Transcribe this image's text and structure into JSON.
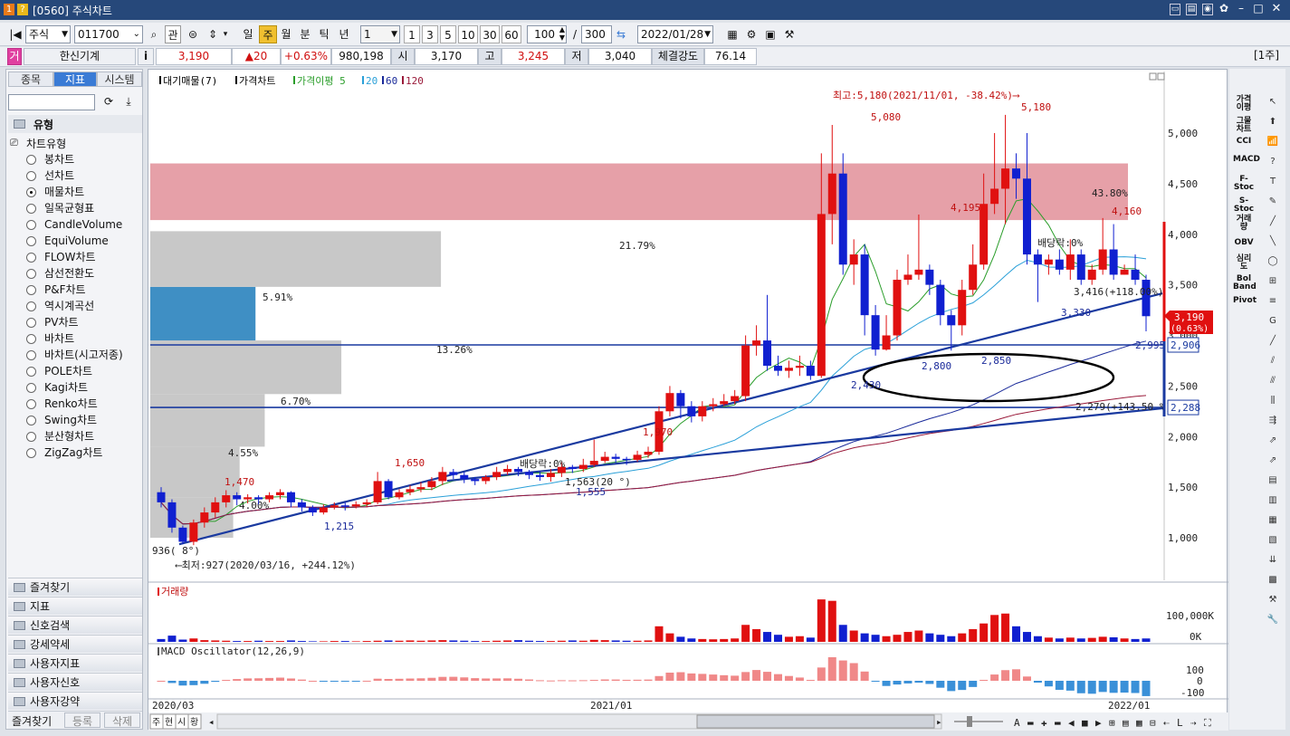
{
  "window": {
    "title": "[0560] 주식차트",
    "badges": [
      "1",
      "?"
    ]
  },
  "toolbar": {
    "market": "주식",
    "code": "011700",
    "gwan": "관",
    "periods": [
      "일",
      "주",
      "월",
      "분",
      "틱",
      "년"
    ],
    "active_period": "주",
    "interval": "1",
    "quick_intervals": [
      "1",
      "3",
      "5",
      "10",
      "30",
      "60"
    ],
    "count": "100",
    "slash": "/",
    "total": "300",
    "date": "2022/01/28"
  },
  "pricebar": {
    "name_badge": "거",
    "company": "한신기계",
    "info": "i",
    "price": "3,190",
    "change": "▲20",
    "change_pct": "+0.63%",
    "volume": "980,198",
    "open_label": "시",
    "open": "3,170",
    "high_label": "고",
    "high": "3,245",
    "low_label": "저",
    "low": "3,040",
    "strength_label": "체결강도",
    "strength": "76.14",
    "period_tag": "[1주]"
  },
  "left": {
    "tabs": [
      "종목",
      "지표",
      "시스템"
    ],
    "active_tab": "지표",
    "group": "유형",
    "tree_root": "차트유형",
    "chart_types": [
      "봉차트",
      "선차트",
      "매물차트",
      "일목균형표",
      "CandleVolume",
      "EquiVolume",
      "FLOW차트",
      "삼선전환도",
      "P&F차트",
      "역시계곡선",
      "PV차트",
      "바차트",
      "바차트(시고저종)",
      "POLE차트",
      "Kagi차트",
      "Renko차트",
      "Swing차트",
      "분산형차트",
      "ZigZag차트"
    ],
    "selected": "매물차트",
    "folders": [
      "즐겨찾기",
      "지표",
      "신호검색",
      "강세약세",
      "사용자지표",
      "사용자신호",
      "사용자강약"
    ],
    "footer": [
      "즐겨찾기",
      "등록",
      "삭제"
    ]
  },
  "legend": {
    "items": [
      "대기매물(7)",
      "가격차트",
      "가격이평 5",
      "20",
      "60",
      "120"
    ],
    "colors": [
      "#000000",
      "#000000",
      "#2a9d2a",
      "#2aa0d8",
      "#1a2a9a",
      "#9a1a3a"
    ]
  },
  "annotations": {
    "high": "최고:5,180(2021/11/01, -38.42%)⟶",
    "low": "⟵최저:927(2020/03/16, +244.12%)",
    "dividend1": "배당락:0%",
    "dividend2": "배당락:0%",
    "pt_5080": "5,080",
    "pt_5180": "5,180",
    "pt_4195": "4,195",
    "pt_4160": "4,160",
    "pct_4380": "43.80%",
    "trend_3416": "3,416(+118.00%)",
    "pt_3330": "3,330",
    "pt_2995": "2,995",
    "pt_2800": "2,800",
    "pt_2850": "2,850",
    "pt_2430": "2,430",
    "trend_2279": "2,279(+143.50 %)",
    "pt_1970": "1,970",
    "pt_1650": "1,650",
    "pt_1470": "1,470",
    "pt_1215": "1,215",
    "pt_1555": "1,555",
    "pt_1563": "1,563(20 °)",
    "pt_936": "936( 8°)",
    "pct_1": "21.79%",
    "pct_2": "5.91%",
    "pct_3": "13.26%",
    "pct_4": "6.70%",
    "pct_5": "4.55%",
    "pct_6": "4.00%",
    "last_price": "3,190",
    "last_pct": "(0.63%)",
    "line_2906": "2,906",
    "line_2288": "2,288"
  },
  "yaxis": [
    "5,000",
    "4,500",
    "4,000",
    "3,500",
    "3,000",
    "2,500",
    "2,000",
    "1,500",
    "1,000"
  ],
  "volume_panel": {
    "title": "거래량",
    "ticks": [
      "100,000K",
      "0K"
    ]
  },
  "macd_panel": {
    "title": "MACD Oscillator(12,26,9)",
    "ticks": [
      "100",
      "0",
      "-100"
    ]
  },
  "xaxis": [
    "2020/03",
    "2021/01",
    "2022/01"
  ],
  "bottom_tabs": [
    "주",
    "현",
    "시",
    "황"
  ],
  "right_indicators": [
    "가격이평",
    "그물차트",
    "CCI",
    "MACD",
    "F-Stoc",
    "S-Stoc",
    "거래량",
    "OBV",
    "심리도",
    "Bol Band",
    "Pivot"
  ],
  "chart_data": {
    "type": "candlestick",
    "ylim": [
      800,
      5200
    ],
    "volume_profile_pct": [
      4.0,
      4.55,
      6.7,
      13.26,
      5.91,
      21.79,
      43.8
    ],
    "h_lines": [
      2906,
      2288
    ],
    "candles": [
      [
        1450,
        1350,
        1500,
        1300
      ],
      [
        1350,
        1100,
        1380,
        1050
      ],
      [
        1100,
        960,
        1120,
        936
      ],
      [
        960,
        1150,
        1180,
        927
      ],
      [
        1150,
        1250,
        1300,
        1100
      ],
      [
        1250,
        1350,
        1400,
        1200
      ],
      [
        1350,
        1420,
        1470,
        1300
      ],
      [
        1420,
        1380,
        1450,
        1320
      ],
      [
        1380,
        1400,
        1430,
        1340
      ],
      [
        1400,
        1380,
        1420,
        1330
      ],
      [
        1380,
        1420,
        1450,
        1350
      ],
      [
        1420,
        1450,
        1480,
        1380
      ],
      [
        1450,
        1350,
        1460,
        1300
      ],
      [
        1350,
        1300,
        1380,
        1260
      ],
      [
        1300,
        1250,
        1320,
        1215
      ],
      [
        1250,
        1300,
        1330,
        1230
      ],
      [
        1300,
        1320,
        1350,
        1280
      ],
      [
        1320,
        1310,
        1350,
        1270
      ],
      [
        1310,
        1330,
        1360,
        1290
      ],
      [
        1330,
        1350,
        1380,
        1300
      ],
      [
        1350,
        1560,
        1650,
        1330
      ],
      [
        1560,
        1400,
        1580,
        1380
      ],
      [
        1400,
        1450,
        1480,
        1380
      ],
      [
        1450,
        1480,
        1520,
        1420
      ],
      [
        1480,
        1500,
        1550,
        1450
      ],
      [
        1500,
        1560,
        1600,
        1470
      ],
      [
        1560,
        1650,
        1700,
        1520
      ],
      [
        1650,
        1620,
        1680,
        1580
      ],
      [
        1620,
        1580,
        1650,
        1540
      ],
      [
        1580,
        1560,
        1600,
        1520
      ],
      [
        1560,
        1600,
        1620,
        1530
      ],
      [
        1600,
        1650,
        1700,
        1570
      ],
      [
        1650,
        1680,
        1720,
        1620
      ],
      [
        1680,
        1650,
        1700,
        1610
      ],
      [
        1650,
        1620,
        1670,
        1580
      ],
      [
        1620,
        1600,
        1650,
        1563
      ],
      [
        1600,
        1640,
        1680,
        1555
      ],
      [
        1640,
        1700,
        1750,
        1600
      ],
      [
        1700,
        1680,
        1720,
        1640
      ],
      [
        1680,
        1720,
        1780,
        1650
      ],
      [
        1720,
        1760,
        1970,
        1700
      ],
      [
        1760,
        1800,
        1850,
        1740
      ],
      [
        1800,
        1780,
        1830,
        1740
      ],
      [
        1780,
        1770,
        1800,
        1720
      ],
      [
        1770,
        1820,
        1860,
        1750
      ],
      [
        1820,
        1850,
        1900,
        1790
      ],
      [
        1850,
        2250,
        2300,
        1820
      ],
      [
        2250,
        2430,
        2500,
        2200
      ],
      [
        2430,
        2300,
        2460,
        2180
      ],
      [
        2300,
        2200,
        2350,
        2140
      ],
      [
        2200,
        2300,
        2350,
        2150
      ],
      [
        2300,
        2320,
        2380,
        2250
      ],
      [
        2320,
        2350,
        2420,
        2300
      ],
      [
        2350,
        2400,
        2460,
        2320
      ],
      [
        2400,
        2900,
        3000,
        2350
      ],
      [
        2900,
        2950,
        3100,
        2800
      ],
      [
        2950,
        2700,
        3400,
        2650
      ],
      [
        2700,
        2650,
        2800,
        2600
      ],
      [
        2650,
        2680,
        2750,
        2580
      ],
      [
        2680,
        2700,
        2800,
        2600
      ],
      [
        2700,
        2600,
        2750,
        2560
      ],
      [
        2600,
        4200,
        4800,
        2580
      ],
      [
        4200,
        4600,
        5080,
        3900
      ],
      [
        4600,
        3700,
        4800,
        3600
      ],
      [
        3700,
        3800,
        3950,
        3500
      ],
      [
        3800,
        3200,
        3900,
        3000
      ],
      [
        3200,
        2860,
        3300,
        2800
      ],
      [
        2860,
        3000,
        3200,
        2850
      ],
      [
        3000,
        3550,
        3650,
        2950
      ],
      [
        3550,
        3600,
        3800,
        3500
      ],
      [
        3600,
        3650,
        4195,
        3550
      ],
      [
        3650,
        3500,
        3700,
        3400
      ],
      [
        3500,
        3200,
        3550,
        3100
      ],
      [
        3200,
        3100,
        3250,
        2850
      ],
      [
        3100,
        3450,
        3550,
        3000
      ],
      [
        3450,
        3700,
        3900,
        3400
      ],
      [
        3700,
        4300,
        4600,
        3650
      ],
      [
        4300,
        4450,
        5000,
        4200
      ],
      [
        4450,
        4650,
        5180,
        4100
      ],
      [
        4650,
        4550,
        4800,
        4350
      ],
      [
        4550,
        3800,
        5000,
        3700
      ],
      [
        3800,
        3700,
        3850,
        3330
      ],
      [
        3700,
        3750,
        3800,
        3600
      ],
      [
        3750,
        3650,
        3850,
        3600
      ],
      [
        3650,
        3800,
        3950,
        3550
      ],
      [
        3800,
        3550,
        3850,
        3500
      ],
      [
        3550,
        3650,
        3700,
        3500
      ],
      [
        3650,
        3850,
        4160,
        3600
      ],
      [
        3850,
        3600,
        4100,
        3550
      ],
      [
        3600,
        3650,
        3700,
        3600
      ],
      [
        3650,
        3550,
        3800,
        3500
      ],
      [
        3550,
        3190,
        3600,
        3040
      ]
    ],
    "volumes": [
      10,
      22,
      8,
      12,
      6,
      5,
      4,
      3,
      3,
      4,
      3,
      3,
      5,
      3,
      2,
      2,
      3,
      3,
      2,
      3,
      4,
      5,
      4,
      5,
      4,
      5,
      6,
      5,
      4,
      3,
      3,
      4,
      5,
      6,
      4,
      3,
      3,
      4,
      5,
      4,
      7,
      6,
      5,
      4,
      4,
      5,
      55,
      30,
      18,
      12,
      10,
      9,
      10,
      12,
      60,
      45,
      35,
      25,
      18,
      20,
      15,
      150,
      145,
      60,
      40,
      30,
      25,
      20,
      25,
      35,
      40,
      30,
      25,
      20,
      30,
      45,
      65,
      95,
      100,
      55,
      35,
      20,
      15,
      12,
      15,
      12,
      14,
      18,
      16,
      12,
      10,
      12
    ]
  }
}
